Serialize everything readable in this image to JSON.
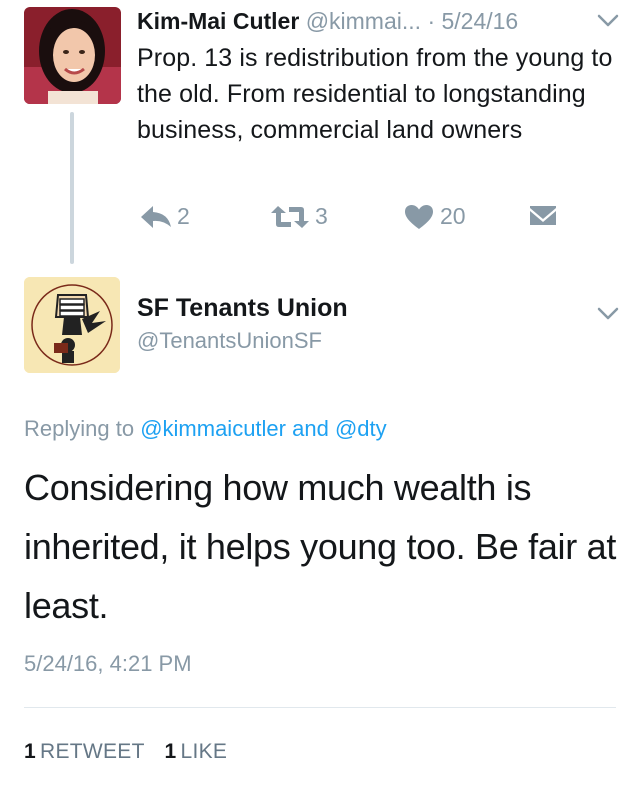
{
  "parent_tweet": {
    "name": "Kim-Mai Cutler",
    "handle": "@kimmai...",
    "date": "· 5/24/16",
    "text": "Prop. 13 is redistribution from the young to the old. From residential to longstanding business, commercial land owners",
    "reply_count": "2",
    "retweet_count": "3",
    "like_count": "20",
    "icons": [
      "reply-icon",
      "retweet-icon",
      "heart-icon",
      "direct-message-icon",
      "chevron-down-icon"
    ]
  },
  "reply_tweet": {
    "name": "SF Tenants Union",
    "handle": "@TenantsUnionSF",
    "avatar_text": "SAN FRANCISCO TENANTS UNION ORGANIZE!",
    "replying_prefix": "Replying to",
    "replying_user1": "@kimmaicutler",
    "replying_and": "and",
    "replying_user2": "@dty",
    "text": "Considering how much wealth is inherited, it helps young too. Be fair at least.",
    "timestamp": "5/24/16, 4:21 PM",
    "retweet_count": "1",
    "retweet_label": "RETWEET",
    "like_count": "1",
    "like_label": "LIKE"
  },
  "colors": {
    "text": "#14171a",
    "secondary": "#8899a6",
    "link": "#1da1f2",
    "divider": "#e1e8ed",
    "thread_line": "#ccd6dd"
  }
}
